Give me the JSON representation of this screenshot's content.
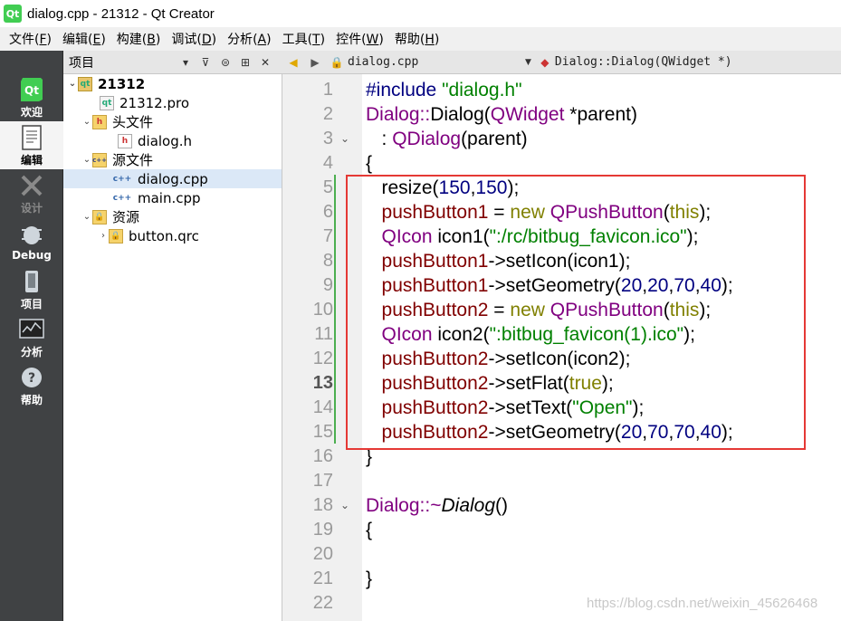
{
  "window": {
    "title": "dialog.cpp - 21312 - Qt Creator",
    "app_icon_text": "Qt"
  },
  "menu": [
    {
      "label": "文件",
      "key": "F"
    },
    {
      "label": "编辑",
      "key": "E"
    },
    {
      "label": "构建",
      "key": "B"
    },
    {
      "label": "调试",
      "key": "D"
    },
    {
      "label": "分析",
      "key": "A"
    },
    {
      "label": "工具",
      "key": "T"
    },
    {
      "label": "控件",
      "key": "W"
    },
    {
      "label": "帮助",
      "key": "H"
    }
  ],
  "modes": {
    "welcome": "欢迎",
    "edit": "编辑",
    "design": "设计",
    "debug": "Debug",
    "projects": "项目",
    "analyze": "分析",
    "help": "帮助"
  },
  "project_pane": {
    "title": "项目",
    "tree": {
      "project": "21312",
      "pro_file": "21312.pro",
      "headers": "头文件",
      "header_file": "dialog.h",
      "sources": "源文件",
      "source_file_1": "dialog.cpp",
      "source_file_2": "main.cpp",
      "resources": "资源",
      "resource_file": "button.qrc"
    }
  },
  "editor": {
    "file": "dialog.cpp",
    "symbol": "Dialog::Dialog(QWidget *)",
    "current_line": 13,
    "line_numbers": [
      "1",
      "2",
      "3",
      "4",
      "5",
      "6",
      "7",
      "8",
      "9",
      "10",
      "11",
      "12",
      "13",
      "14",
      "15",
      "16",
      "17",
      "18",
      "19",
      "20",
      "21",
      "22"
    ]
  },
  "code": {
    "l1": {
      "pre": "#include",
      "str": "\"dialog.h\""
    },
    "l2": {
      "cls": "Dialog",
      "sep": "::",
      "fn": "Dialog(",
      "ty": "QWidget",
      "rest": " *parent)"
    },
    "l3": {
      "a": "   : ",
      "ty": "QDialog",
      "rest": "(parent)"
    },
    "l4": {
      "t": "{"
    },
    "l5": {
      "a": "   resize(",
      "n1": "150",
      "c": ",",
      "n2": "150",
      "b": ");"
    },
    "l6": {
      "a": "   ",
      "mem": "pushButton1",
      "eq": " = ",
      "kw": "new",
      "sp": " ",
      "ty": "QPushButton",
      "op": "(",
      "kw2": "this",
      "cl": ");"
    },
    "l7": {
      "a": "   ",
      "ty": "QIcon",
      "rest": " icon1(",
      "str": "\":/rc/bitbug_favicon.ico\"",
      "cl": ");"
    },
    "l8": {
      "a": "   ",
      "mem": "pushButton1",
      "rest": "->setIcon(icon1);"
    },
    "l9": {
      "a": "   ",
      "mem": "pushButton1",
      "rest": "->setGeometry(",
      "n1": "20",
      "c1": ",",
      "n2": "20",
      "c2": ",",
      "n3": "70",
      "c3": ",",
      "n4": "40",
      "cl": ");"
    },
    "l10": {
      "a": "   ",
      "mem": "pushButton2",
      "eq": " = ",
      "kw": "new",
      "sp": " ",
      "ty": "QPushButton",
      "op": "(",
      "kw2": "this",
      "cl": ");"
    },
    "l11": {
      "a": "   ",
      "ty": "QIcon",
      "rest": " icon2(",
      "str": "\":bitbug_favicon(1).ico\"",
      "cl": ");"
    },
    "l12": {
      "a": "   ",
      "mem": "pushButton2",
      "rest": "->setIcon(icon2);"
    },
    "l13": {
      "a": "   ",
      "mem": "pushButton2",
      "rest": "->setFlat(",
      "kw": "true",
      "cl": ");"
    },
    "l14": {
      "a": "   ",
      "mem": "pushButton2",
      "rest": "->setText(",
      "str": "\"Open\"",
      "cl": ");"
    },
    "l15": {
      "a": "   ",
      "mem": "pushButton2",
      "rest": "->setGeometry(",
      "n1": "20",
      "c1": ",",
      "n2": "70",
      "c2": ",",
      "n3": "70",
      "c3": ",",
      "n4": "40",
      "cl": ");"
    },
    "l16": {
      "t": "}"
    },
    "l18": {
      "cls": "Dialog",
      "sep": "::~",
      "fn": "Dialog",
      "rest": "()"
    },
    "l19": {
      "t": "{"
    },
    "l21": {
      "t": "}"
    }
  },
  "watermark": "https://blog.csdn.net/weixin_45626468",
  "colors": {
    "highlight_box": "#e53935",
    "keyword": "#808000",
    "type": "#800080",
    "member": "#800000",
    "number": "#000080",
    "string": "#008000"
  }
}
